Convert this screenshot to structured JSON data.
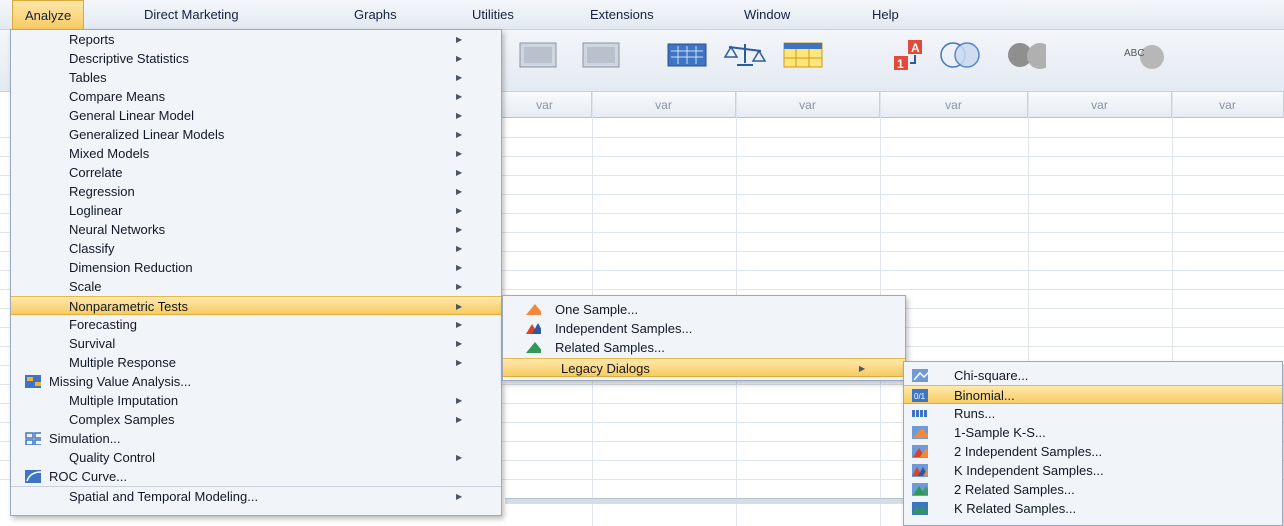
{
  "menubar": {
    "items": [
      {
        "label": "Analyze"
      },
      {
        "label": "Direct Marketing"
      },
      {
        "label": "Graphs"
      },
      {
        "label": "Utilities"
      },
      {
        "label": "Extensions"
      },
      {
        "label": "Window"
      },
      {
        "label": "Help"
      }
    ]
  },
  "toolbar": {
    "icons": [
      "recall-dialog-icon",
      "undo-icon",
      "go-to-case-icon",
      "weight-cases-icon",
      "split-file-icon",
      "value-labels-icon",
      "use-sets-icon",
      "show-all-icon",
      "spelling-icon"
    ],
    "spelling_text": "ABC"
  },
  "grid": {
    "column_header": "var",
    "columns": [
      "var",
      "var",
      "var",
      "var",
      "var",
      "var"
    ]
  },
  "analyze_menu": {
    "items": [
      {
        "label": "Reports",
        "submenu": true
      },
      {
        "label": "Descriptive Statistics",
        "submenu": true
      },
      {
        "label": "Tables",
        "submenu": true
      },
      {
        "label": "Compare Means",
        "submenu": true
      },
      {
        "label": "General Linear Model",
        "submenu": true
      },
      {
        "label": "Generalized Linear Models",
        "submenu": true
      },
      {
        "label": "Mixed Models",
        "submenu": true
      },
      {
        "label": "Correlate",
        "submenu": true
      },
      {
        "label": "Regression",
        "submenu": true
      },
      {
        "label": "Loglinear",
        "submenu": true
      },
      {
        "label": "Neural Networks",
        "submenu": true
      },
      {
        "label": "Classify",
        "submenu": true
      },
      {
        "label": "Dimension Reduction",
        "submenu": true
      },
      {
        "label": "Scale",
        "submenu": true
      },
      {
        "label": "Nonparametric Tests",
        "submenu": true,
        "highlighted": true
      },
      {
        "label": "Forecasting",
        "submenu": true
      },
      {
        "label": "Survival",
        "submenu": true
      },
      {
        "label": "Multiple Response",
        "submenu": true
      },
      {
        "label": "Missing Value Analysis...",
        "icon": "missing-value-icon"
      },
      {
        "label": "Multiple Imputation",
        "submenu": true
      },
      {
        "label": "Complex Samples",
        "submenu": true
      },
      {
        "label": "Simulation...",
        "icon": "simulation-icon"
      },
      {
        "label": "Quality Control",
        "submenu": true
      },
      {
        "label": "ROC Curve...",
        "icon": "roc-curve-icon"
      },
      {
        "label": "Spatial and Temporal Modeling...",
        "submenu": true
      }
    ]
  },
  "nonparametric_menu": {
    "items": [
      {
        "label": "One Sample...",
        "icon": "one-sample-icon"
      },
      {
        "label": "Independent Samples...",
        "icon": "independent-samples-icon"
      },
      {
        "label": "Related Samples...",
        "icon": "related-samples-icon"
      },
      {
        "label": "Legacy Dialogs",
        "submenu": true,
        "highlighted": true
      }
    ]
  },
  "legacy_menu": {
    "items": [
      {
        "label": "Chi-square...",
        "icon": "chi-square-icon"
      },
      {
        "label": "Binomial...",
        "icon": "binomial-icon",
        "highlighted": true,
        "icon_text": "0/1"
      },
      {
        "label": "Runs...",
        "icon": "runs-icon"
      },
      {
        "label": "1-Sample K-S...",
        "icon": "one-sample-ks-icon"
      },
      {
        "label": "2 Independent Samples...",
        "icon": "two-independent-samples-icon"
      },
      {
        "label": "K Independent Samples...",
        "icon": "k-independent-samples-icon"
      },
      {
        "label": "2 Related Samples...",
        "icon": "two-related-samples-icon"
      },
      {
        "label": "K Related Samples...",
        "icon": "k-related-samples-icon"
      }
    ]
  },
  "colors": {
    "highlight_top": "#ffe9ad",
    "highlight_bottom": "#f7cb62",
    "menu_bg": "#f1f4f8",
    "chart_blue": "#3b6fd1",
    "chart_red": "#d9422b",
    "chart_green": "#2f9a55",
    "chart_orange": "#f08a3a"
  }
}
